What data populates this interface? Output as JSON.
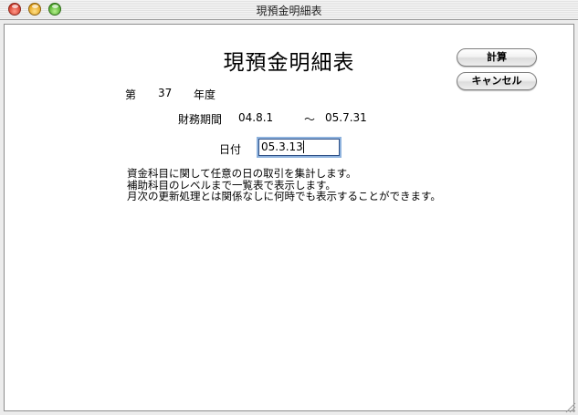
{
  "window": {
    "title": "現預金明細表"
  },
  "heading": "現預金明細表",
  "period": {
    "label_prefix": "第",
    "number": "37",
    "label_suffix": "年度"
  },
  "fiscal": {
    "label": "財務期間",
    "start": "04.8.1",
    "separator": "～",
    "end": "05.7.31"
  },
  "date_field": {
    "label": "日付",
    "value": "05.3.13"
  },
  "buttons": {
    "calculate": "計算",
    "cancel": "キャンセル"
  },
  "description": [
    "資金科目に関して任意の日の取引を集計します。",
    "補助科目のレベルまで一覧表で表示します。",
    "月次の更新処理とは関係なしに何時でも表示することができます。"
  ]
}
